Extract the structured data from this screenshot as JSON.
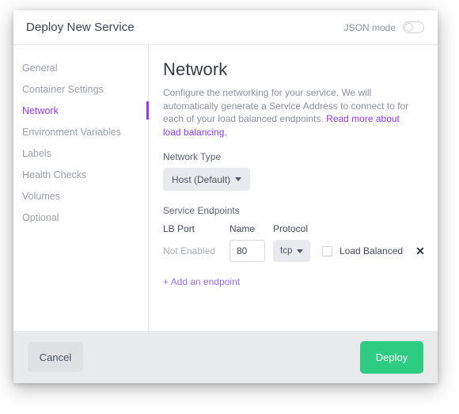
{
  "header": {
    "title": "Deploy New Service",
    "json_mode_label": "JSON mode",
    "json_mode_enabled": false
  },
  "sidebar": {
    "items": [
      {
        "label": "General",
        "active": false
      },
      {
        "label": "Container Settings",
        "active": false
      },
      {
        "label": "Network",
        "active": true
      },
      {
        "label": "Environment Variables",
        "active": false
      },
      {
        "label": "Labels",
        "active": false
      },
      {
        "label": "Health Checks",
        "active": false
      },
      {
        "label": "Volumes",
        "active": false
      },
      {
        "label": "Optional",
        "active": false
      }
    ]
  },
  "content": {
    "title": "Network",
    "description_part1": "Configure the networking for your service. We will automatically generate a Service Address to connect to for each of your load balanced endpoints. ",
    "description_link": "Read more about load balancing.",
    "network_type": {
      "label": "Network Type",
      "selected": "Host (Default)"
    },
    "endpoints": {
      "title": "Service Endpoints",
      "columns": {
        "lb_port": "LB Port",
        "name": "Name",
        "protocol": "Protocol"
      },
      "rows": [
        {
          "lb_port": "Not Enabled",
          "name_value": "80",
          "name_placeholder": "",
          "protocol": "tcp",
          "load_balanced_label": "Load Balanced",
          "load_balanced_checked": false,
          "remove_icon": "✕"
        }
      ],
      "add_link": "+ Add an endpoint"
    }
  },
  "footer": {
    "cancel_label": "Cancel",
    "deploy_label": "Deploy"
  },
  "colors": {
    "accent_purple": "#9039ff",
    "link_purple": "#9b6cf2",
    "deploy_green": "#2ecb82",
    "footer_gray": "#e9eaec",
    "muted_text": "#9a9fa8"
  }
}
